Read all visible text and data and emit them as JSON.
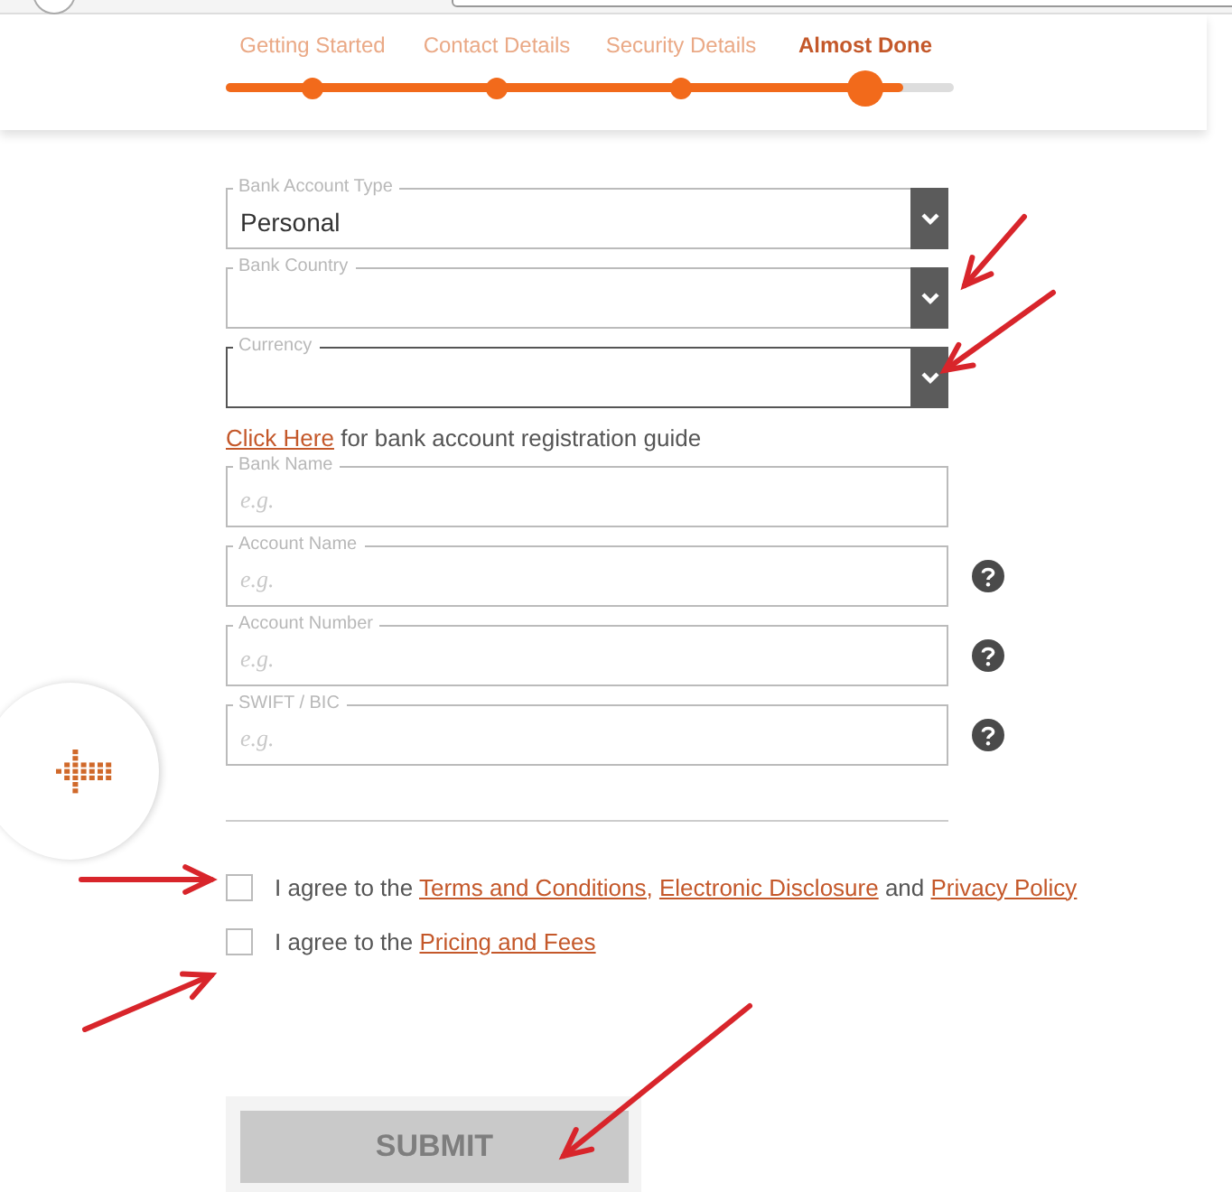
{
  "steps": [
    {
      "label": "Getting Started",
      "selected": false
    },
    {
      "label": "Contact Details",
      "selected": false
    },
    {
      "label": "Security Details",
      "selected": false
    },
    {
      "label": "Almost Done",
      "selected": true
    }
  ],
  "progress": {
    "level": 0.93
  },
  "selects": [
    {
      "label": "Bank Account Type",
      "value": "Personal",
      "focused": false
    },
    {
      "label": "Bank Country",
      "focused": false
    },
    {
      "label": "Currency",
      "focused": true
    }
  ],
  "guide": {
    "link": "Click Here",
    "text": "for bank account registration guide"
  },
  "inputs": [
    {
      "label": "Bank Name",
      "placeholder": "e.g.",
      "help": false
    },
    {
      "label": "Account Name",
      "placeholder": "e.g.",
      "help": true
    },
    {
      "label": "Account Number",
      "placeholder": "e.g.",
      "help": true
    },
    {
      "label": "SWIFT / BIC",
      "placeholder": "e.g.",
      "help": true
    }
  ],
  "agreements": [
    {
      "checked": false,
      "parts": [
        {
          "kind": "text",
          "text": "I agree to the "
        },
        {
          "kind": "link",
          "text": "Terms and Conditions,"
        },
        {
          "kind": "link",
          "text": "Electronic Disclosure"
        },
        {
          "kind": "text",
          "text": " and "
        },
        {
          "kind": "link",
          "text": "Privacy Policy"
        }
      ]
    },
    {
      "checked": false,
      "parts": [
        {
          "kind": "text",
          "text": "I agree to the "
        },
        {
          "kind": "link",
          "text": "Pricing and Fees"
        }
      ]
    }
  ],
  "submit": {
    "label": "SUBMIT",
    "disabled": true
  }
}
